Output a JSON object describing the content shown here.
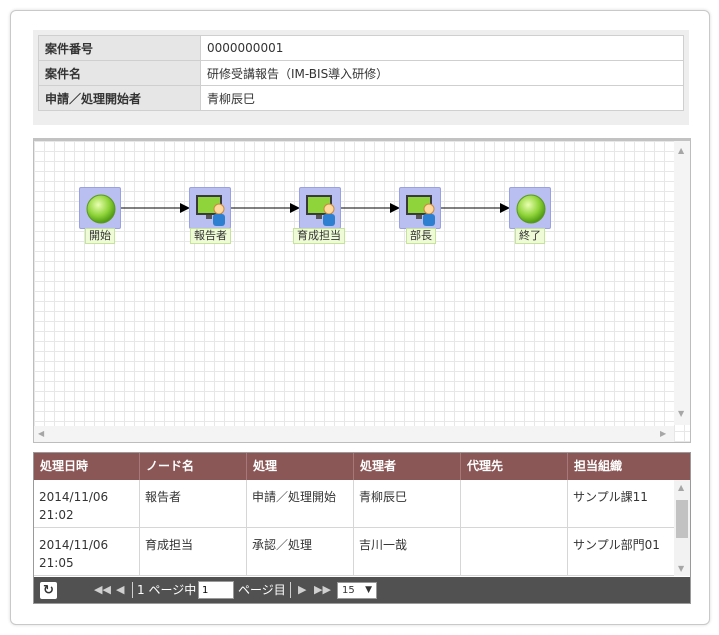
{
  "info": {
    "rows": [
      {
        "label": "案件番号",
        "value": "0000000001"
      },
      {
        "label": "案件名",
        "value": "研修受講報告（IM-BIS導入研修）"
      },
      {
        "label": "申請／処理開始者",
        "value": "青柳辰巳"
      }
    ]
  },
  "flow": {
    "nodes": [
      {
        "label": "開始",
        "icon": "start-circle-icon"
      },
      {
        "label": "報告者",
        "icon": "user-monitor-icon"
      },
      {
        "label": "育成担当",
        "icon": "user-monitor-icon"
      },
      {
        "label": "部長",
        "icon": "user-monitor-icon"
      },
      {
        "label": "終了",
        "icon": "end-circle-icon"
      }
    ]
  },
  "history": {
    "columns": [
      "処理日時",
      "ノード名",
      "処理",
      "処理者",
      "代理先",
      "担当組織"
    ],
    "rows": [
      {
        "date": "2014/11/06",
        "time": "21:02",
        "node": "報告者",
        "action": "申請／処理開始",
        "user": "青柳辰巳",
        "proxy": "",
        "org": "サンプル課11"
      },
      {
        "date": "2014/11/06",
        "time": "21:05",
        "node": "育成担当",
        "action": "承認／処理",
        "user": "吉川一哉",
        "proxy": "",
        "org": "サンプル部門01"
      }
    ]
  },
  "pager": {
    "page_prefix": "1 ページ中",
    "page_value": "1",
    "page_suffix": "ページ目",
    "page_size": "15"
  },
  "colors": {
    "grid_header": "#8b5656",
    "pager_bg": "#515151",
    "node_bg": "#b9bff0",
    "label_bg": "#eefbd6"
  }
}
